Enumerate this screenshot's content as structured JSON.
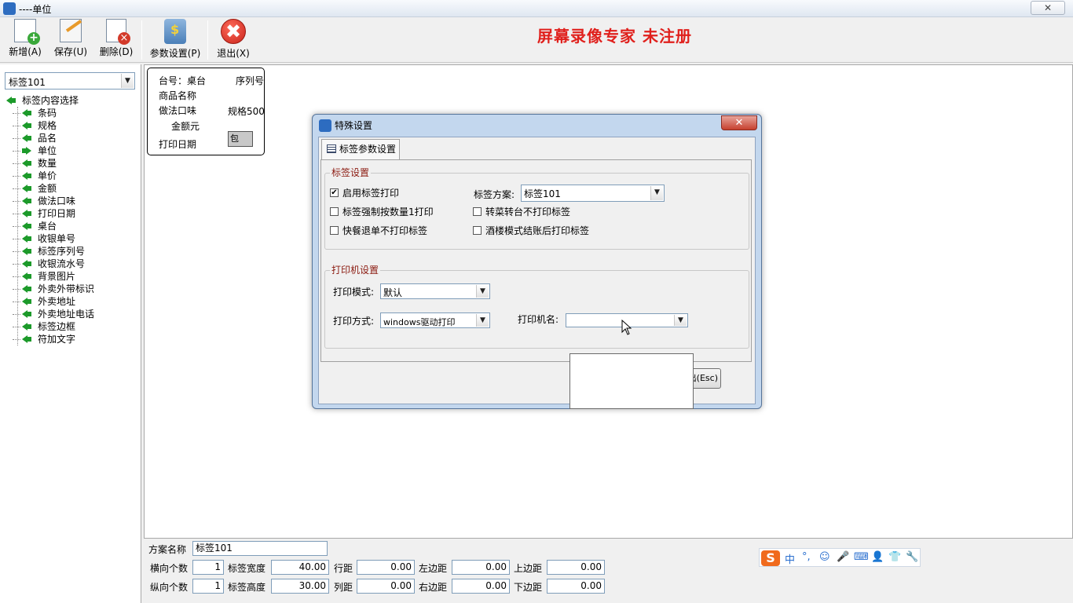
{
  "window": {
    "title": "----单位",
    "close_glyph": "✕"
  },
  "toolbar": {
    "buttons": [
      {
        "label": "新增(A)",
        "icon": "new-document-icon"
      },
      {
        "label": "保存(U)",
        "icon": "save-edit-icon"
      },
      {
        "label": "删除(D)",
        "icon": "delete-document-icon"
      },
      {
        "label": "参数设置(P)",
        "icon": "parameter-settings-icon"
      },
      {
        "label": "退出(X)",
        "icon": "exit-icon"
      }
    ],
    "exit_glyph": "✖"
  },
  "watermark": "屏幕录像专家  未注册",
  "left_panel": {
    "scheme_value": "标签101",
    "tree_root": "标签内容选择",
    "tree_items": [
      "条码",
      "规格",
      "品名",
      "单位",
      "数量",
      "单价",
      "金额",
      "做法口味",
      "打印日期",
      "桌台",
      "收银单号",
      "标签序列号",
      "收银流水号",
      "背景图片",
      "外卖外带标识",
      "外卖地址",
      "外卖地址电话",
      "标签边框",
      "符加文字"
    ]
  },
  "label_preview": {
    "table": "台号：桌台",
    "serial": "序列号",
    "product_name": "商品名称",
    "flavor": "做法口味",
    "spec": "规格500",
    "amount": "金额元",
    "print_date": "打印日期",
    "bag": "包"
  },
  "bottom_panel": {
    "scheme_name_label": "方案名称",
    "scheme_name_value": "标签101",
    "h_count_label": "横向个数",
    "h_count_value": "1",
    "label_width_label": "标签宽度",
    "label_width_value": "40.00",
    "row_gap_label": "行距",
    "row_gap_value": "0.00",
    "left_margin_label": "左边距",
    "left_margin_value": "0.00",
    "top_margin_label": "上边距",
    "top_margin_value": "0.00",
    "v_count_label": "纵向个数",
    "v_count_value": "1",
    "label_height_label": "标签高度",
    "label_height_value": "30.00",
    "col_gap_label": "列距",
    "col_gap_value": "0.00",
    "right_margin_label": "右边距",
    "right_margin_value": "0.00",
    "bottom_margin_label": "下边距",
    "bottom_margin_value": "0.00"
  },
  "ime": {
    "logo": "S",
    "items": [
      "中",
      "°,",
      "☺",
      "🎤",
      "⌨",
      "👤",
      "👕",
      "🔧"
    ]
  },
  "dialog": {
    "title": "特殊设置",
    "close_glyph": "✕",
    "tab_label": "标签参数设置",
    "label_group_title": "标签设置",
    "enable_label_print": "启用标签打印",
    "enable_label_print_checked": true,
    "force_by_qty": "标签强制按数量1打印",
    "force_by_qty_checked": false,
    "fast_refund_no_print": "快餐退单不打印标签",
    "fast_refund_no_print_checked": false,
    "label_scheme_label": "标签方案:",
    "label_scheme_value": "标签101",
    "transfer_no_print": "转菜转台不打印标签",
    "transfer_no_print_checked": false,
    "restaurant_mode_print": "酒楼模式结账后打印标签",
    "restaurant_mode_print_checked": false,
    "printer_group_title": "打印机设置",
    "print_mode_label": "打印模式:",
    "print_mode_value": "默认",
    "print_method_label": "打印方式:",
    "print_method_value": "windows驱动打印",
    "printer_name_label": "打印机名:",
    "printer_name_value": "",
    "exit_button": "出(Esc)",
    "check_glyph": "✔"
  }
}
